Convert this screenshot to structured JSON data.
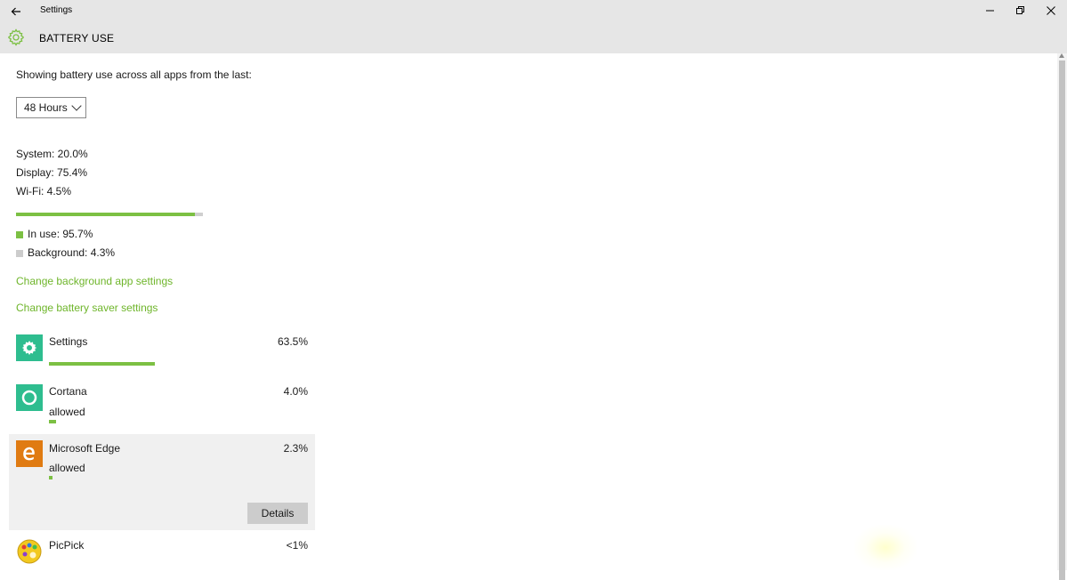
{
  "window": {
    "title": "Settings",
    "controls": {
      "minimize": "—",
      "restore": "❐",
      "close": "✕"
    }
  },
  "header": {
    "title": "BATTERY USE",
    "icon": "gear-icon",
    "accent_color": "#7cc043"
  },
  "main": {
    "showing_label": "Showing battery use across all apps from the last:",
    "period_select": {
      "value": "48 Hours"
    },
    "stats": [
      "System: 20.0%",
      "Display: 75.4%",
      "Wi-Fi: 4.5%"
    ],
    "usage_bar": {
      "in_use_percent": 95.7,
      "fill_color": "#7cc043",
      "track_color": "#cfcfcf"
    },
    "legend": [
      {
        "label": "In use: 95.7%",
        "color": "#7cc043"
      },
      {
        "label": "Background: 4.3%",
        "color": "#cccccc"
      }
    ],
    "links": {
      "background_apps": "Change background app settings",
      "battery_saver": "Change battery saver settings"
    },
    "apps": [
      {
        "name": "Settings",
        "percent": "63.5%",
        "sub": "",
        "bar_percent": 63.5,
        "icon": "settings-gear-icon",
        "icon_color": "#2ebd8f"
      },
      {
        "name": "Cortana",
        "percent": "4.0%",
        "sub": "allowed",
        "bar_percent": 4.0,
        "icon": "cortana-circle-icon",
        "icon_color": "#2ebd8f"
      },
      {
        "name": "Microsoft Edge",
        "percent": "2.3%",
        "sub": "allowed",
        "bar_percent": 2.3,
        "icon": "edge-icon",
        "icon_color": "#e07b12",
        "selected": true,
        "details_label": "Details"
      },
      {
        "name": "PicPick",
        "percent": "<1%",
        "sub": "",
        "bar_percent": 0.5,
        "icon": "picpick-palette-icon",
        "icon_color": "#f2c91f"
      }
    ]
  }
}
